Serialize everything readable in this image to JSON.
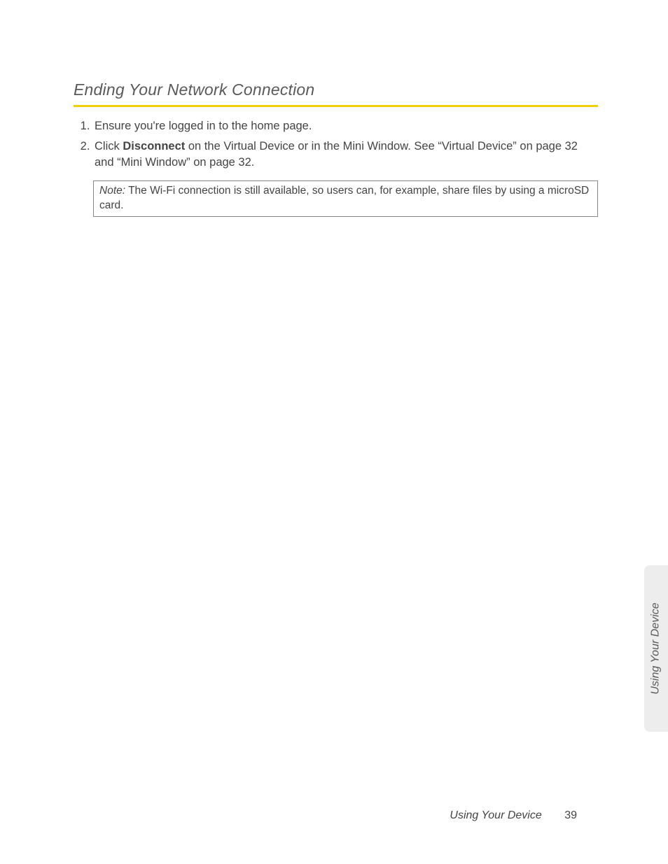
{
  "heading": "Ending Your Network Connection",
  "list": {
    "item1": "Ensure you're logged in to the home page.",
    "item2_pre": "Click ",
    "item2_bold": "Disconnect",
    "item2_post": " on the Virtual Device or in the Mini Window. See “Virtual Device” on page 32 and “Mini Window” on page 32."
  },
  "note": {
    "label": "Note:",
    "text": "  The Wi-Fi connection is still available, so users can, for example, share files by using a microSD card."
  },
  "side_tab": "Using Your Device",
  "footer": {
    "section": "Using Your Device",
    "page": "39"
  }
}
